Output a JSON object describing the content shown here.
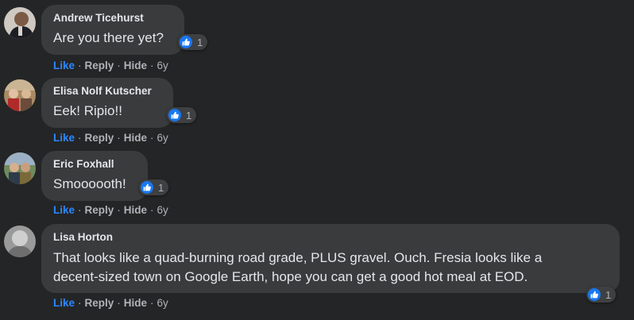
{
  "comments": [
    {
      "author": "Andrew Ticehurst",
      "text": "Are you there yet?",
      "reaction_count": "1",
      "reaction_icon": "thumbs-up-icon",
      "actions": {
        "like": "Like",
        "reply": "Reply",
        "hide": "Hide",
        "age": "6y"
      }
    },
    {
      "author": "Elisa Nolf Kutscher",
      "text": "Eek! Ripio!!",
      "reaction_count": "1",
      "reaction_icon": "thumbs-up-icon",
      "actions": {
        "like": "Like",
        "reply": "Reply",
        "hide": "Hide",
        "age": "6y"
      }
    },
    {
      "author": "Eric Foxhall",
      "text": "Smoooooth!",
      "reaction_count": "1",
      "reaction_icon": "thumbs-up-icon",
      "actions": {
        "like": "Like",
        "reply": "Reply",
        "hide": "Hide",
        "age": "6y"
      }
    },
    {
      "author": "Lisa Horton",
      "text_lines": [
        "That looks like a quad-burning road grade, PLUS gravel. Ouch. Fresia looks like a",
        "decent-sized town on Google Earth, hope you can get a good hot meal at EOD."
      ],
      "reaction_count": "1",
      "reaction_icon": "thumbs-up-icon",
      "actions": {
        "like": "Like",
        "reply": "Reply",
        "hide": "Hide",
        "age": "6y"
      }
    }
  ],
  "separator": "·",
  "colors": {
    "background": "#242526",
    "bubble": "#3a3b3c",
    "primary_text": "#e4e6eb",
    "secondary_text": "#b0b3b8",
    "like_blue": "#2d88ff",
    "reaction_badge": "#1877f2"
  }
}
